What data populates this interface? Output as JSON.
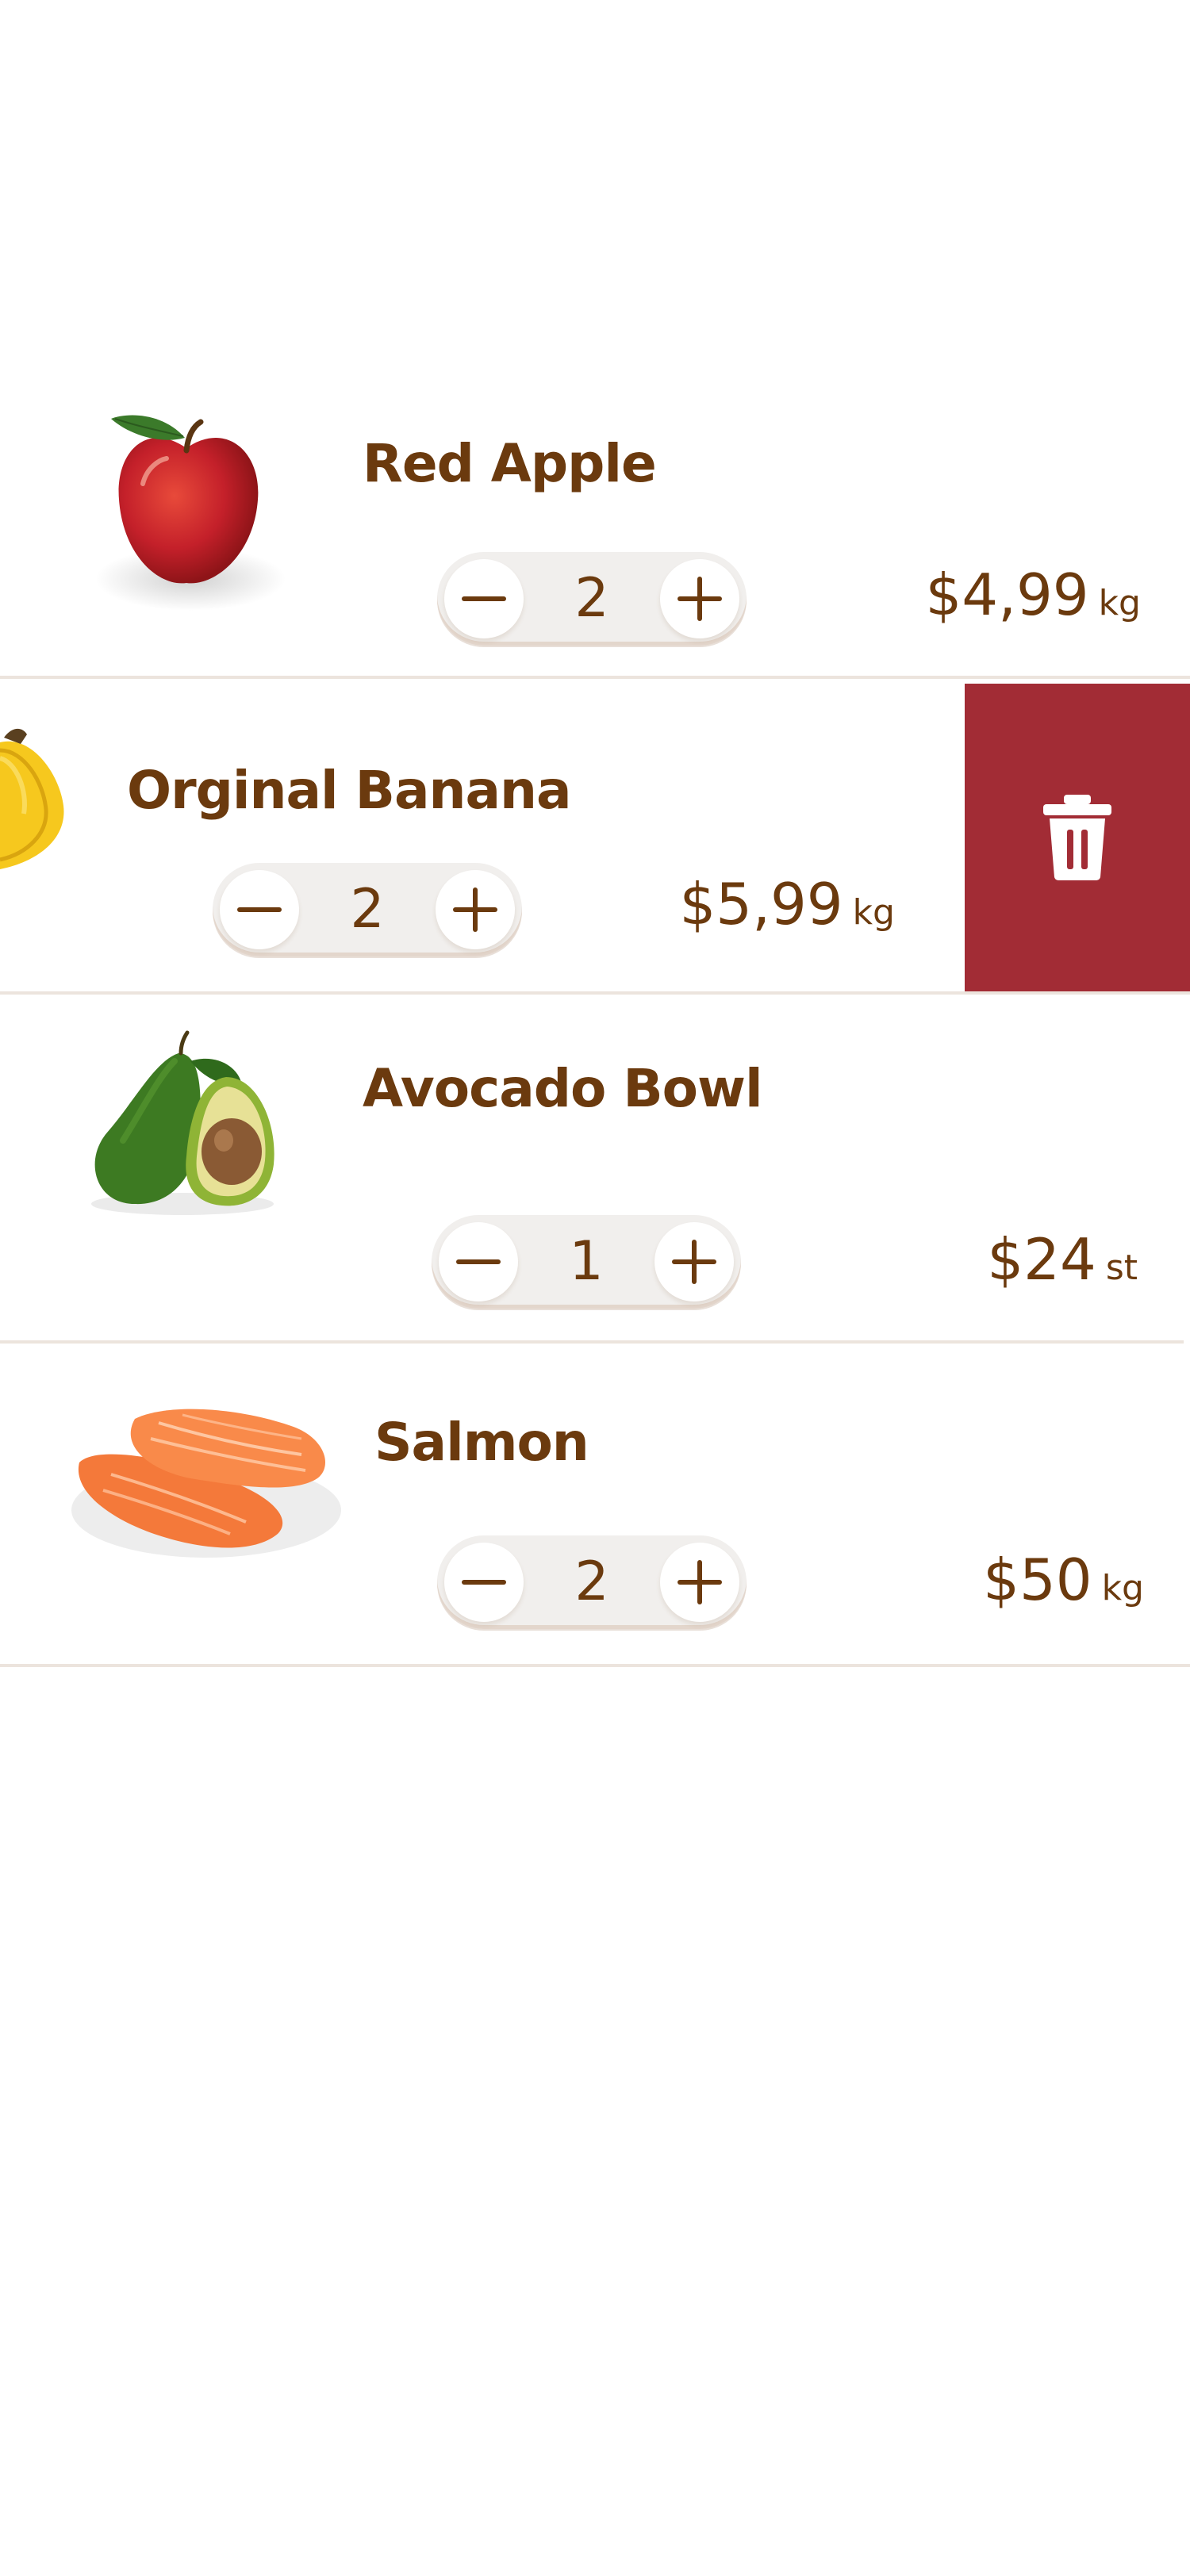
{
  "cart": {
    "items": [
      {
        "name": "Red Apple",
        "quantity": "2",
        "price": "$4,99",
        "unit": "kg",
        "image": "red-apple"
      },
      {
        "name": "Orginal Banana",
        "quantity": "2",
        "price": "$5,99",
        "unit": "kg",
        "image": "banana",
        "swiped_state": "delete action revealed"
      },
      {
        "name": "Avocado Bowl",
        "quantity": "1",
        "price": "$24",
        "unit": "st",
        "image": "avocado"
      },
      {
        "name": "Salmon",
        "quantity": "2",
        "price": "$50",
        "unit": "kg",
        "image": "salmon"
      }
    ]
  },
  "icons": {
    "decrease": "minus-icon",
    "increase": "plus-icon",
    "delete": "trash-icon"
  },
  "colors": {
    "text": "#6b3a0e",
    "delete_background": "#a22c35",
    "divider": "#ece4dd",
    "stepper_background": "#f1efed"
  }
}
